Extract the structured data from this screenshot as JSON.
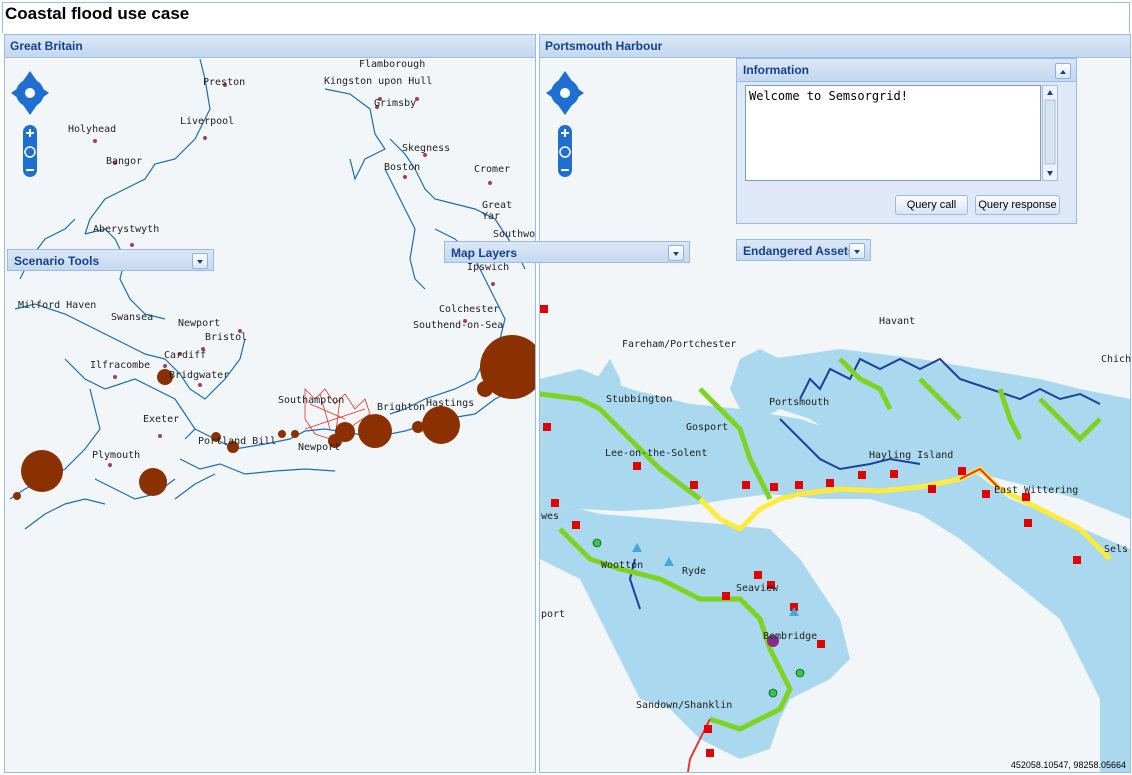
{
  "app": {
    "title": "Coastal flood use case"
  },
  "left_map": {
    "title": "Great Britain",
    "places": [
      "Flamborough",
      "Preston",
      "Kingston upon Hull",
      "Grimsby",
      "Liverpool",
      "Holyhead",
      "Bangor",
      "Skegness",
      "Boston",
      "Cromer",
      "Great Yar",
      "Southwo",
      "Aberystwyth",
      "Ipswich",
      "Milford Haven",
      "Swansea",
      "Newport",
      "Bristol",
      "Colchester",
      "Southend-on-Sea",
      "Cardiff",
      "Ilfracombe",
      "Bridgwater",
      "Southampton",
      "Brighton",
      "Hastings",
      "Exeter",
      "Portland Bill",
      "Newport",
      "Plymouth"
    ]
  },
  "right_map": {
    "title": "Portsmouth Harbour",
    "places": [
      "Havant",
      "Fareham/Portchester",
      "Chich",
      "Stubbington",
      "Portsmouth",
      "Gosport",
      "Lee-on-the-Solent",
      "Hayling Island",
      "East Wittering",
      "Sels",
      "Wootton",
      "Ryde",
      "Seaview",
      "Bembridge",
      "Sandown/Shanklin",
      "port",
      "wes"
    ],
    "coordinates": "452058.10547, 98258.05664"
  },
  "scenario_tools": {
    "title": "Scenario Tools"
  },
  "map_layers": {
    "title": "Map Layers"
  },
  "endangered_assets": {
    "title": "Endangered Assets"
  },
  "information": {
    "title": "Information",
    "text": "Welcome to Semsorgrid!",
    "query_call_label": "Query call",
    "query_response_label": "Query response"
  },
  "colors": {
    "header_text": "#15428b",
    "flood_circle": "#8b3000",
    "sea": "#a9d8ef",
    "nav": "#1e6fd0"
  }
}
